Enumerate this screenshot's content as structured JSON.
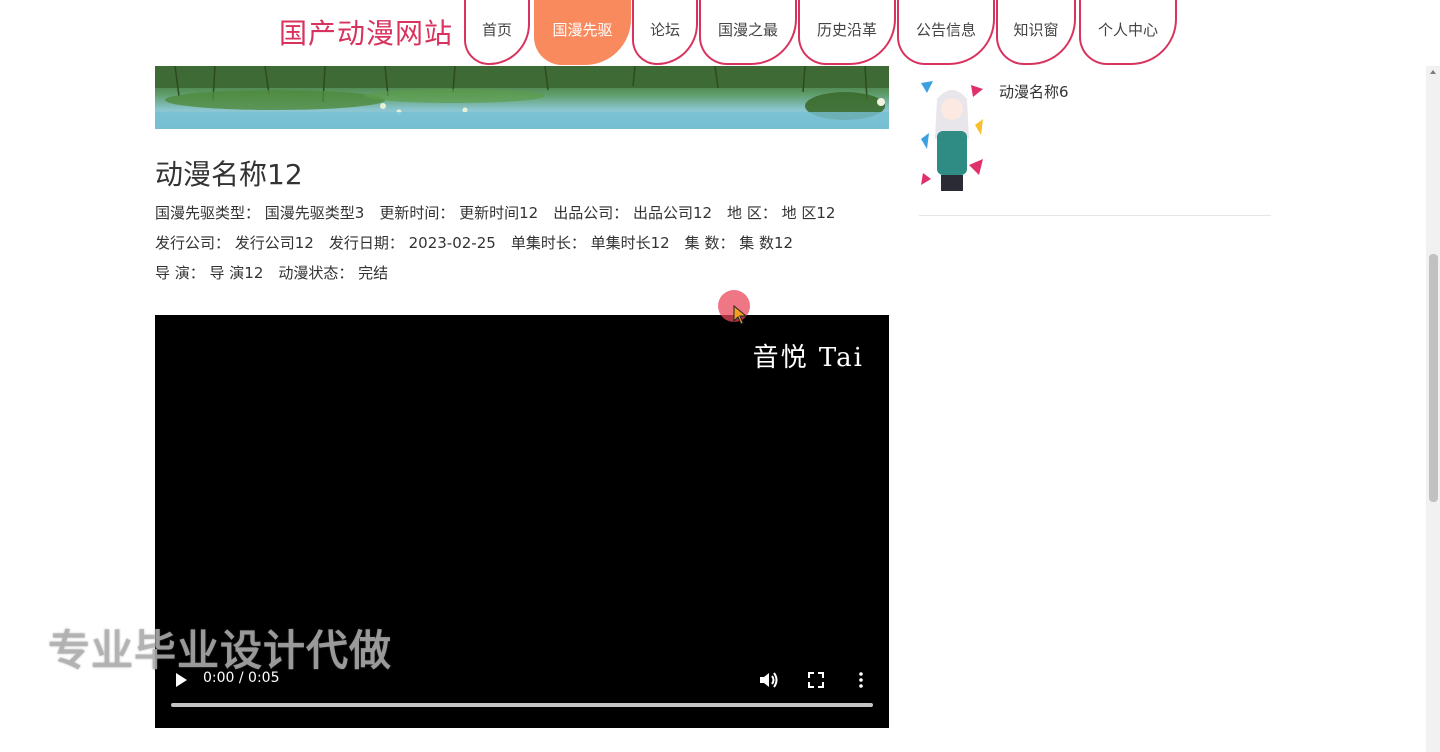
{
  "site": {
    "title": "国产动漫网站"
  },
  "nav": {
    "items": [
      {
        "label": "首页"
      },
      {
        "label": "国漫先驱"
      },
      {
        "label": "论坛"
      },
      {
        "label": "国漫之最"
      },
      {
        "label": "历史沿革"
      },
      {
        "label": "公告信息"
      },
      {
        "label": "知识窗"
      },
      {
        "label": "个人中心"
      }
    ],
    "active_index": 1,
    "accent_color": "#d8335e",
    "active_color": "#f98a5e"
  },
  "detail": {
    "title": "动漫名称12",
    "fields": {
      "type": "国漫先驱类型：  国漫先驱类型3",
      "update_time": "更新时间：  更新时间12",
      "producer": "出品公司：  出品公司12",
      "region": "地 区：  地 区12",
      "publisher": "发行公司：  发行公司12",
      "release_date": "发行日期：  2023-02-25",
      "episode_length": "单集时长：  单集时长12",
      "episodes": "集 数：  集 数12",
      "director": "导 演：  导 演12",
      "status": "动漫状态：  完结"
    }
  },
  "video": {
    "watermark": "音悦 Tai",
    "time": "0:00 / 0:05",
    "progress": 0.0,
    "controls": [
      "play-icon",
      "volume-icon",
      "fullscreen-icon",
      "more-vert-icon"
    ]
  },
  "overlay_watermark": "专业毕业设计代做",
  "sidebar": {
    "items": [
      {
        "name": "动漫名称6"
      }
    ]
  }
}
